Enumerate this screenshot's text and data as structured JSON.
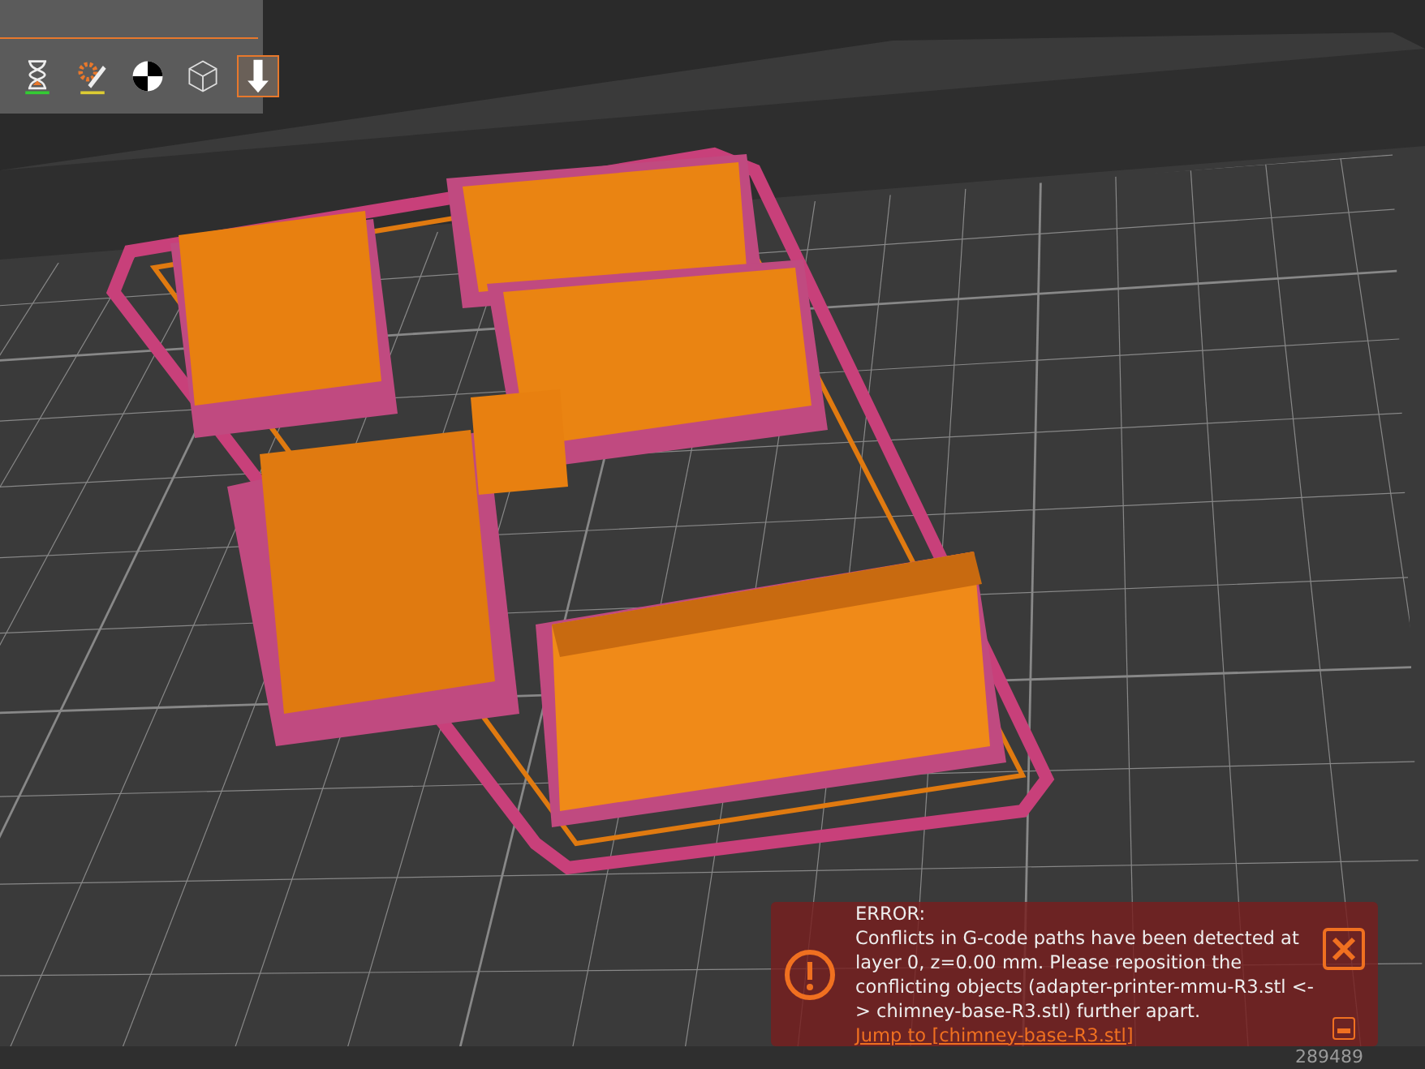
{
  "toolbar": {
    "items": [
      {
        "kind": "hourglass",
        "selected": false
      },
      {
        "kind": "gear-pencil",
        "selected": false
      },
      {
        "kind": "checker",
        "selected": false
      },
      {
        "kind": "cube",
        "selected": false
      },
      {
        "kind": "arrow-down",
        "selected": true
      }
    ]
  },
  "notification": {
    "kind": "error",
    "heading": "ERROR:",
    "message": "Conflicts in G-code paths have been detected at layer 0, z=0.00 mm. Please reposition the conflicting objects (adapter-printer-mmu-R3.stl <-> chimney-base-R3.stl) further apart.",
    "link": "Jump to [chimney-base-R3.stl]"
  },
  "status_bar": {
    "value": "289489"
  }
}
